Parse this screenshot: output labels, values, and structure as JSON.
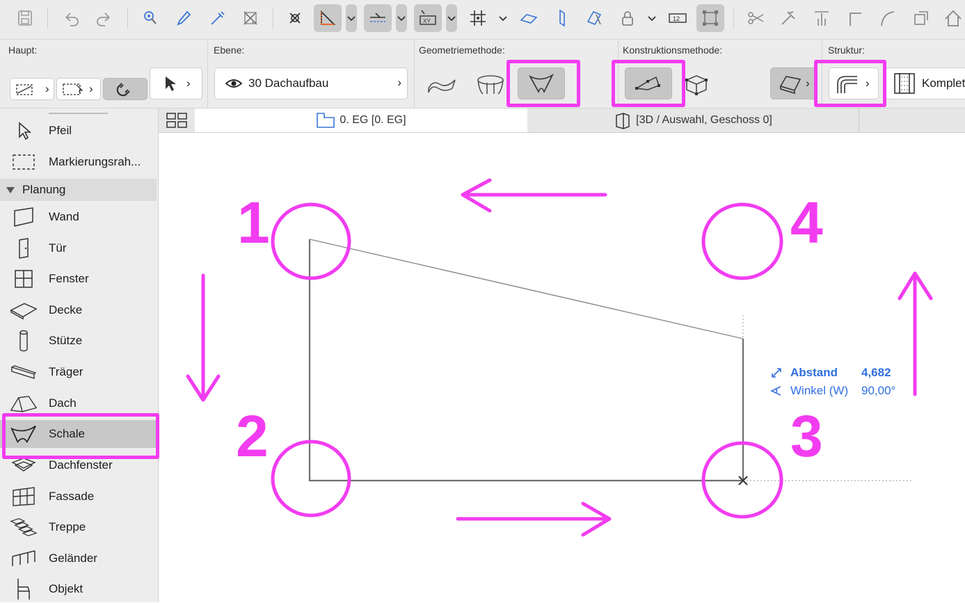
{
  "toolbar": {
    "icons": [
      "save-icon",
      "undo-icon",
      "redo-icon",
      "find-select-icon",
      "pick-up-icon",
      "inject-icon",
      "magic-wand-icon",
      "cursor-snap-icon",
      "guide-lines-icon",
      "snap-guides-icon",
      "coordinates-icon",
      "gravity-icon",
      "grid-snap-icon",
      "edit-plane-icon",
      "nudge-icon",
      "lock-icon",
      "suspend-groups-icon",
      "measure-icon",
      "trim-icon",
      "adjust-icon",
      "elevate-icon",
      "fillet-icon",
      "offset-icon",
      "home-icon"
    ]
  },
  "infobox": {
    "haupt_label": "Haupt:",
    "ebene_label": "Ebene:",
    "ebene_value": "30 Dachaufbau",
    "geometrie_label": "Geometriemethode:",
    "konstruktion_label": "Konstruktionsmethode:",
    "struktur_label": "Struktur:",
    "struktur_value": "Komplet"
  },
  "tabs": [
    {
      "label": "0. EG [0. EG]"
    },
    {
      "label": "[3D / Auswahl, Geschoss 0]"
    }
  ],
  "sidebar": {
    "top_items": [
      {
        "label": "Pfeil",
        "icon": "arrow-icon"
      },
      {
        "label": "Markierungsrah...",
        "icon": "marquee-icon"
      }
    ],
    "section": "Planung",
    "items": [
      {
        "label": "Wand",
        "icon": "wall-icon"
      },
      {
        "label": "Tür",
        "icon": "door-icon"
      },
      {
        "label": "Fenster",
        "icon": "window-icon"
      },
      {
        "label": "Decke",
        "icon": "slab-icon"
      },
      {
        "label": "Stütze",
        "icon": "column-icon"
      },
      {
        "label": "Träger",
        "icon": "beam-icon"
      },
      {
        "label": "Dach",
        "icon": "roof-icon"
      },
      {
        "label": "Schale",
        "icon": "shell-icon",
        "selected": true
      },
      {
        "label": "Dachfenster",
        "icon": "skylight-icon"
      },
      {
        "label": "Fassade",
        "icon": "curtain-wall-icon"
      },
      {
        "label": "Treppe",
        "icon": "stair-icon"
      },
      {
        "label": "Geländer",
        "icon": "railing-icon"
      },
      {
        "label": "Objekt",
        "icon": "object-icon"
      }
    ]
  },
  "canvas": {
    "markers": [
      "1",
      "2",
      "3",
      "4"
    ],
    "tracker": {
      "distance_label": "Abstand",
      "distance_value": "4,682",
      "angle_label": "Winkel (W)",
      "angle_value": "90,00°"
    }
  },
  "colors": {
    "annotation": "#f23cf0",
    "tracker": "#2f6fe0",
    "line": "#6e6e6e"
  }
}
